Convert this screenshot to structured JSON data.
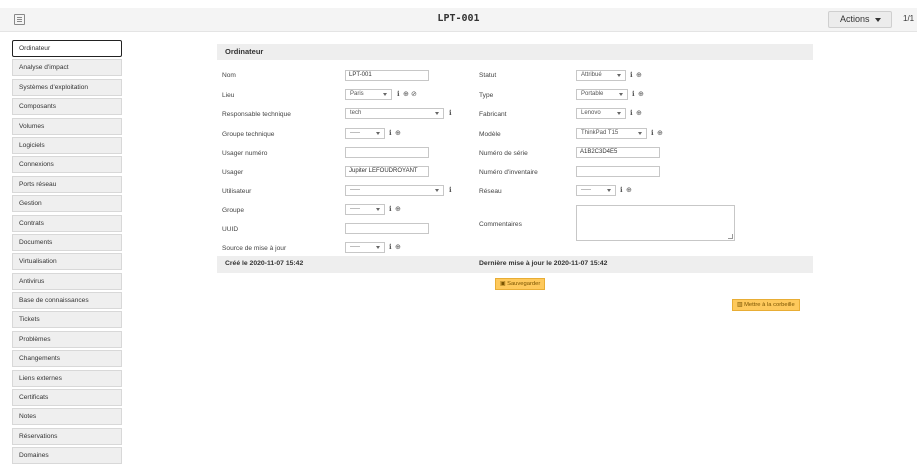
{
  "header": {
    "title": "LPT-001",
    "actions_label": "Actions",
    "pager": "1/1"
  },
  "sidebar": {
    "tabs": [
      {
        "label": "Ordinateur",
        "active": true
      },
      {
        "label": "Analyse d'impact"
      },
      {
        "label": "Systèmes d'exploitation"
      },
      {
        "label": "Composants"
      },
      {
        "label": "Volumes"
      },
      {
        "label": "Logiciels"
      },
      {
        "label": "Connexions"
      },
      {
        "label": "Ports réseau"
      },
      {
        "label": "Gestion"
      },
      {
        "label": "Contrats"
      },
      {
        "label": "Documents"
      },
      {
        "label": "Virtualisation"
      },
      {
        "label": "Antivirus"
      },
      {
        "label": "Base de connaissances"
      },
      {
        "label": "Tickets"
      },
      {
        "label": "Problèmes"
      },
      {
        "label": "Changements"
      },
      {
        "label": "Liens externes"
      },
      {
        "label": "Certificats"
      },
      {
        "label": "Notes"
      },
      {
        "label": "Réservations"
      },
      {
        "label": "Domaines"
      }
    ]
  },
  "form": {
    "section_title": "Ordinateur",
    "left": {
      "nom": {
        "label": "Nom",
        "value": "LPT-001"
      },
      "lieu": {
        "label": "Lieu",
        "value": "Paris"
      },
      "responsable": {
        "label": "Responsable technique",
        "value": "tech"
      },
      "groupe_tech": {
        "label": "Groupe technique",
        "value": "-----"
      },
      "usager_num": {
        "label": "Usager numéro",
        "value": ""
      },
      "usager": {
        "label": "Usager",
        "value": "Jupiter LEFOUDROYANT"
      },
      "utilisateur": {
        "label": "Utilisateur",
        "value": "-----"
      },
      "groupe": {
        "label": "Groupe",
        "value": "-----"
      },
      "uuid": {
        "label": "UUID",
        "value": ""
      },
      "source_maj": {
        "label": "Source de mise à jour",
        "value": "-----"
      }
    },
    "right": {
      "statut": {
        "label": "Statut",
        "value": "Attribué"
      },
      "type": {
        "label": "Type",
        "value": "Portable"
      },
      "fabricant": {
        "label": "Fabricant",
        "value": "Lenovo"
      },
      "modele": {
        "label": "Modèle",
        "value": "ThinkPad T15"
      },
      "serie": {
        "label": "Numéro de série",
        "value": "A1B2C3D4E5"
      },
      "inventaire": {
        "label": "Numéro d'inventaire",
        "value": ""
      },
      "reseau": {
        "label": "Réseau",
        "value": "-----"
      },
      "commentaires": {
        "label": "Commentaires",
        "value": ""
      }
    },
    "created": "Créé le 2020-11-07 15:42",
    "updated": "Dernière mise à jour le 2020-11-07 15:42",
    "save_label": "Sauvegarder",
    "trash_label": "Mettre à la corbeille"
  },
  "icons": {
    "info": "info-icon",
    "add": "add-icon",
    "link": "link-icon",
    "save": "save-icon",
    "trash": "trash-icon"
  },
  "colors": {
    "accent_button": "#fec95c",
    "section_bg": "#eeeeee"
  }
}
